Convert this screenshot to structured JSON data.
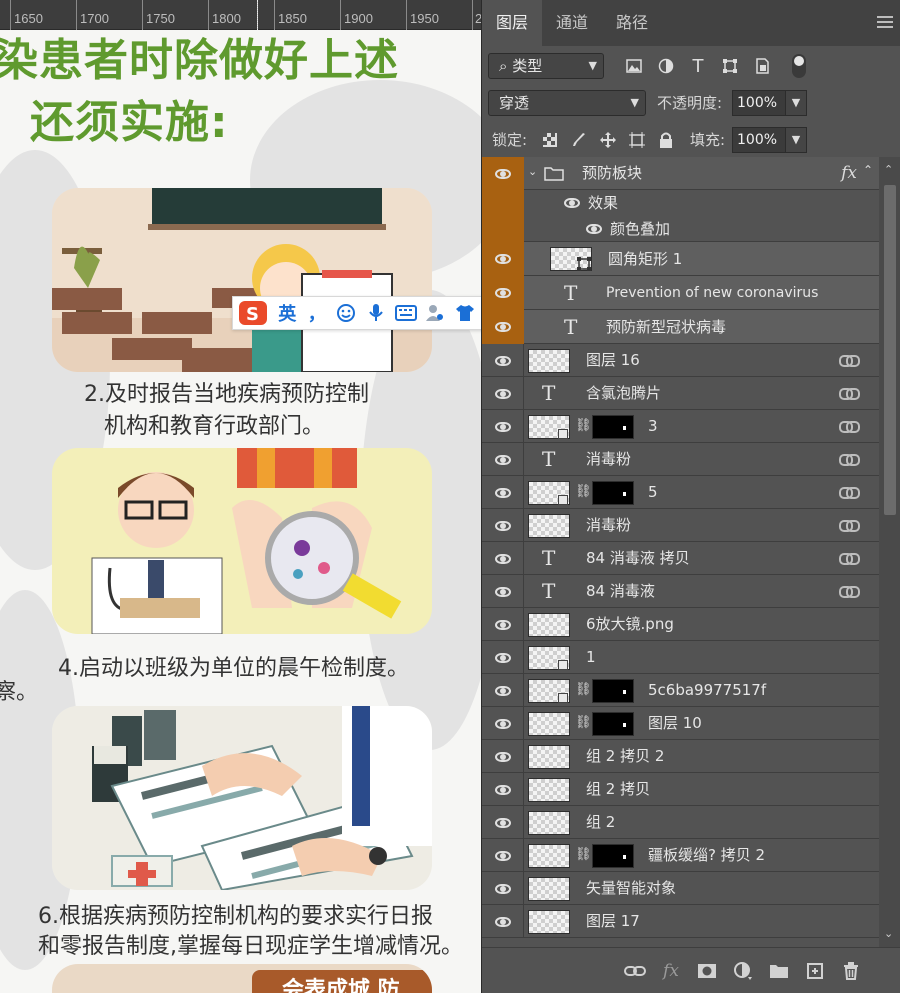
{
  "canvas": {
    "ruler": [
      "1650",
      "1700",
      "1750",
      "1800",
      "1850",
      "1900",
      "1950",
      "2"
    ],
    "heading_line1": "染患者时除做好上述",
    "heading_line2": "还须实施:",
    "caption2_line1": "2.及时报告当地疾病预防控制",
    "caption2_line2": "机构和教育行政部门。",
    "caption4": "4.启动以班级为单位的晨午检制度。",
    "caption6_line1": "6.根据疾病预防控制机构的要求实行日报",
    "caption6_line2": "和零报告制度,掌握每日现症学生增减情况。",
    "side_char": "察。",
    "bottom_text": "会表成城 防"
  },
  "ime": {
    "lang": "英",
    "punct": "，"
  },
  "panel": {
    "tabs": [
      "图层",
      "通道",
      "路径"
    ],
    "filter_label": "类型",
    "blend_mode": "穿透",
    "opacity_label": "不透明度:",
    "opacity_value": "100%",
    "lock_label": "锁定:",
    "fill_label": "填充:",
    "fill_value": "100%",
    "fx": "fx",
    "layers": [
      {
        "name": "预防板块",
        "kind": "group"
      },
      {
        "name": "效果",
        "kind": "effect"
      },
      {
        "name": "颜色叠加",
        "kind": "effect2"
      },
      {
        "name": "圆角矩形 1",
        "kind": "shape"
      },
      {
        "name": "Prevention of new coronavirus",
        "kind": "text-in"
      },
      {
        "name": "预防新型冠状病毒",
        "kind": "text-in"
      },
      {
        "name": "图层 16",
        "kind": "pixel"
      },
      {
        "name": "含氯泡腾片",
        "kind": "text"
      },
      {
        "name": "3",
        "kind": "masked"
      },
      {
        "name": "消毒粉",
        "kind": "text"
      },
      {
        "name": "5",
        "kind": "masked"
      },
      {
        "name": "消毒粉",
        "kind": "pixel"
      },
      {
        "name": "84 消毒液 拷贝",
        "kind": "text"
      },
      {
        "name": "84 消毒液",
        "kind": "text"
      },
      {
        "name": "6放大镜.png",
        "kind": "pixel"
      },
      {
        "name": "1",
        "kind": "smart"
      },
      {
        "name": "5c6ba9977517f",
        "kind": "masked"
      },
      {
        "name": "图层 10",
        "kind": "masked-plain"
      },
      {
        "name": "组 2 拷贝 2",
        "kind": "pixel"
      },
      {
        "name": "组 2 拷贝",
        "kind": "pixel"
      },
      {
        "name": "组 2",
        "kind": "pixel"
      },
      {
        "name": "疆板缓缁? 拷贝 2",
        "kind": "masked-plain"
      },
      {
        "name": "矢量智能对象",
        "kind": "pixel"
      },
      {
        "name": "图层 17",
        "kind": "pixel"
      }
    ]
  }
}
